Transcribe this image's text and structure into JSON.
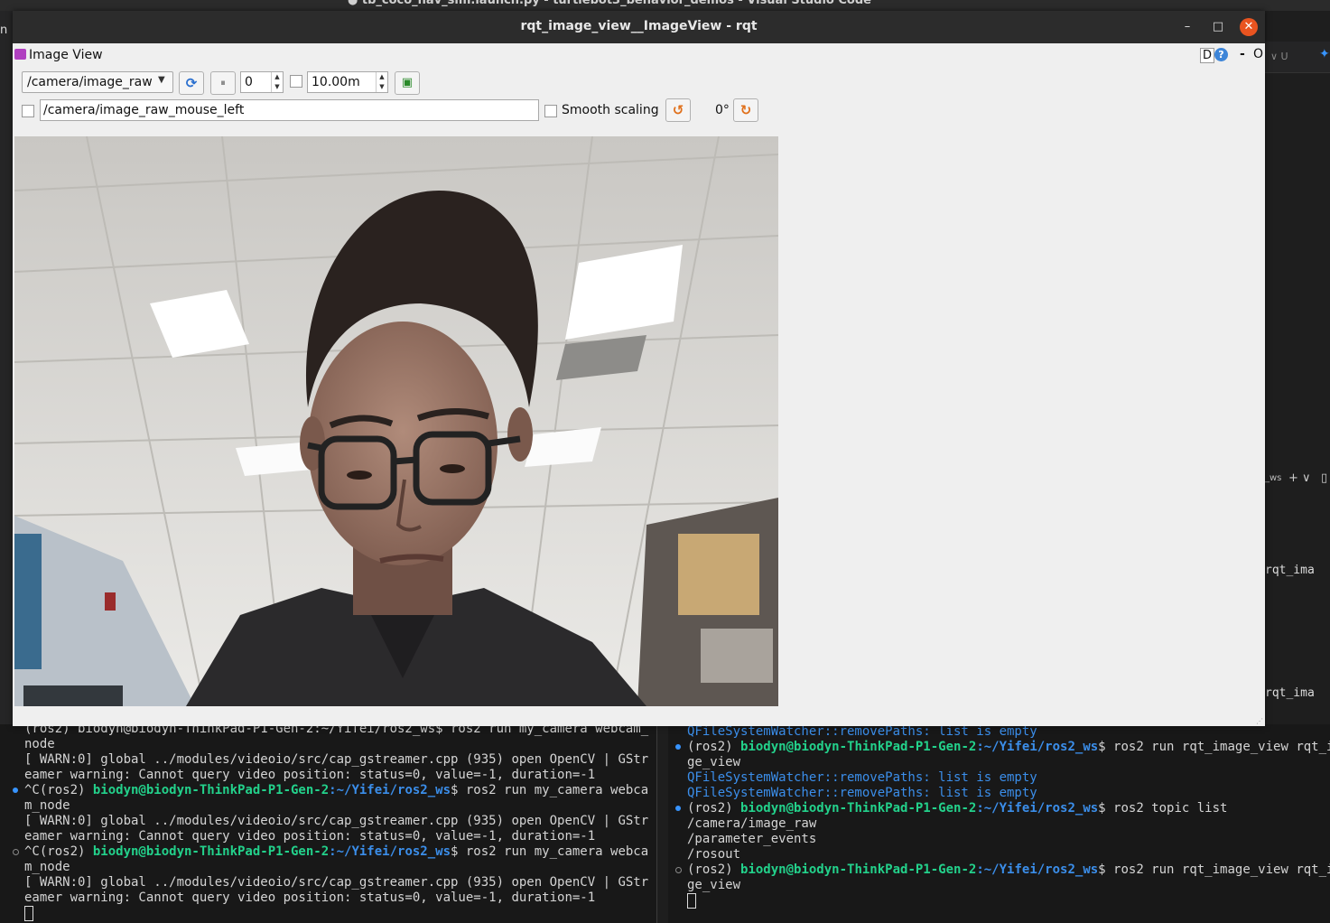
{
  "background": {
    "vscode_title": "● tb_coco_nav_sim.launch.py - turtlebot3_behavior_demos - Visual Studio Code",
    "left_edge_char": "n",
    "right_tab_label": "∨ U",
    "right_panel_ws": "_ws",
    "right_panel_plus": "+ ∨",
    "right_truncated_1": "rqt_ima",
    "right_truncated_2": "rqt_ima"
  },
  "terminal_left": {
    "lines": [
      {
        "type": "plain",
        "text": "(ros2) biodyn@biodyn-ThinkPad-P1-Gen-2:~/Yifei/ros2_ws$ ros2 run my_camera webcam_"
      },
      {
        "type": "plain",
        "text": "node"
      },
      {
        "type": "plain",
        "text": "[ WARN:0] global ../modules/videoio/src/cap_gstreamer.cpp (935) open OpenCV | GStr"
      },
      {
        "type": "plain",
        "text": "eamer warning: Cannot query video position: status=0, value=-1, duration=-1"
      },
      {
        "type": "prompt",
        "pre": "^C(ros2) ",
        "user": "biodyn@biodyn-ThinkPad-P1-Gen-2",
        "path": ":~/Yifei/ros2_ws",
        "cmd": "$ ros2 run my_camera webca"
      },
      {
        "type": "plain",
        "text": "m_node"
      },
      {
        "type": "plain",
        "text": "[ WARN:0] global ../modules/videoio/src/cap_gstreamer.cpp (935) open OpenCV | GStr"
      },
      {
        "type": "plain",
        "text": "eamer warning: Cannot query video position: status=0, value=-1, duration=-1"
      },
      {
        "type": "prompt",
        "pre": "^C(ros2) ",
        "user": "biodyn@biodyn-ThinkPad-P1-Gen-2",
        "path": ":~/Yifei/ros2_ws",
        "cmd": "$ ros2 run my_camera webca"
      },
      {
        "type": "plain",
        "text": "m_node"
      },
      {
        "type": "plain",
        "text": "[ WARN:0] global ../modules/videoio/src/cap_gstreamer.cpp (935) open OpenCV | GStr"
      },
      {
        "type": "plain",
        "text": "eamer warning: Cannot query video position: status=0, value=-1, duration=-1"
      }
    ]
  },
  "terminal_right": {
    "lines": [
      {
        "type": "blue",
        "text": "QFileSystemWatcher::removePaths: list is empty"
      },
      {
        "type": "prompt",
        "pre": "(ros2) ",
        "user": "biodyn@biodyn-ThinkPad-P1-Gen-2",
        "path": ":~/Yifei/ros2_ws",
        "cmd": "$ ros2 run rqt_image_view rqt_ima"
      },
      {
        "type": "plain",
        "text": "ge_view"
      },
      {
        "type": "blue",
        "text": "QFileSystemWatcher::removePaths: list is empty"
      },
      {
        "type": "blue",
        "text": "QFileSystemWatcher::removePaths: list is empty"
      },
      {
        "type": "prompt",
        "pre": "(ros2) ",
        "user": "biodyn@biodyn-ThinkPad-P1-Gen-2",
        "path": ":~/Yifei/ros2_ws",
        "cmd": "$ ros2 topic list"
      },
      {
        "type": "plain",
        "text": "/camera/image_raw"
      },
      {
        "type": "plain",
        "text": "/parameter_events"
      },
      {
        "type": "plain",
        "text": "/rosout"
      },
      {
        "type": "prompt",
        "pre": "(ros2) ",
        "user": "biodyn@biodyn-ThinkPad-P1-Gen-2",
        "path": ":~/Yifei/ros2_ws",
        "cmd": "$ ros2 run rqt_image_view rqt_ima"
      },
      {
        "type": "plain",
        "text": "ge_view"
      }
    ]
  },
  "rqt": {
    "window_title": "rqt_image_view__ImageView - rqt",
    "plugin_title": "Image View",
    "help_d": "D",
    "help_q": "?",
    "header_dash": "-",
    "header_o": "O",
    "topic_selected": "/camera/image_raw",
    "zoom_value": "0",
    "max_range_value": "10.00m",
    "publish_topic": "/camera/image_raw_mouse_left",
    "smooth_scaling_label": "Smooth scaling",
    "rotation_label": "0°",
    "icons": {
      "refresh": "refresh-icon",
      "pause": "pause-icon",
      "save": "save-icon",
      "rotate_left": "rotate-left-icon",
      "rotate_right": "rotate-right-icon"
    }
  },
  "colors": {
    "prompt_green": "#23d18b",
    "path_blue": "#3b8eea",
    "close_orange": "#e95420"
  }
}
